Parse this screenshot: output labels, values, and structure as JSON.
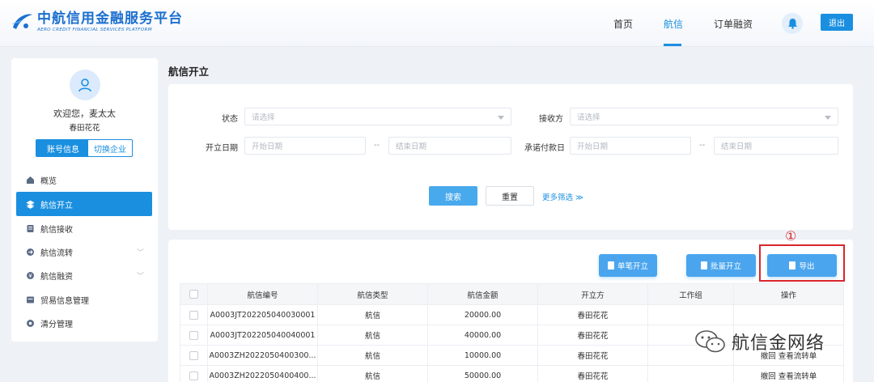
{
  "brand": {
    "name_cn": "中航信用金融服务平台",
    "name_en": "AERO CREDIT FINANCIAL SERVICES PLATFORM",
    "color": "#1c6fd0"
  },
  "nav": {
    "items": [
      {
        "label": "首页",
        "active": false
      },
      {
        "label": "航信",
        "active": true
      },
      {
        "label": "订单融资",
        "active": false
      }
    ],
    "bell_icon": "bell-icon",
    "logout_label": "退出"
  },
  "sidebar": {
    "welcome": "欢迎您，麦太太",
    "company": "春田花花",
    "account_btn": "账号信息",
    "switch_btn": "切换企业",
    "menu": [
      {
        "label": "概览",
        "icon": "home-icon",
        "active": false,
        "expandable": false
      },
      {
        "label": "航信开立",
        "icon": "layers-icon",
        "active": true,
        "expandable": false
      },
      {
        "label": "航信接收",
        "icon": "receive-icon",
        "active": false,
        "expandable": false
      },
      {
        "label": "航信流转",
        "icon": "transfer-icon",
        "active": false,
        "expandable": true
      },
      {
        "label": "航信融资",
        "icon": "finance-icon",
        "active": false,
        "expandable": true
      },
      {
        "label": "贸易信息管理",
        "icon": "trade-icon",
        "active": false,
        "expandable": false
      },
      {
        "label": "清分管理",
        "icon": "clearing-icon",
        "active": false,
        "expandable": false
      }
    ]
  },
  "page": {
    "title": "航信开立"
  },
  "filters": {
    "status_label": "状态",
    "status_placeholder": "请选择",
    "receiver_label": "接收方",
    "receiver_placeholder": "请选择",
    "open_date_label": "开立日期",
    "open_start": "开始日期",
    "open_end": "结束日期",
    "pay_date_label": "承诺付款日",
    "pay_start": "开始日期",
    "pay_end": "结束日期",
    "range_sep": "--",
    "search_btn": "搜索",
    "reset_btn": "重置",
    "more_link": "更多筛选 ≫"
  },
  "actions": {
    "single_open": "单笔开立",
    "batch_open": "批量开立",
    "export": "导出",
    "annotation": "①",
    "highlight_color": "#d9262b"
  },
  "table": {
    "headers": [
      "航信编号",
      "航信类型",
      "航信金额",
      "开立方",
      "工作组",
      "操作"
    ],
    "rows": [
      {
        "id": "A0003JT202205040030001",
        "type": "航信",
        "amount": "20000.00",
        "issuer": "春田花花",
        "group": "",
        "ops": ""
      },
      {
        "id": "A0003JT202205040040001",
        "type": "航信",
        "amount": "40000.00",
        "issuer": "春田花花",
        "group": "",
        "ops": ""
      },
      {
        "id": "A0003ZH2022050400300...",
        "type": "航信",
        "amount": "10000.00",
        "issuer": "春田花花",
        "group": "",
        "ops": "撤回 查看流转单"
      },
      {
        "id": "A0003ZH2022050400400...",
        "type": "航信",
        "amount": "50000.00",
        "issuer": "春田花花",
        "group": "",
        "ops": "撤回 查看流转单"
      }
    ]
  },
  "watermark": {
    "text": "航信金网络",
    "icon": "wechat-icon"
  }
}
